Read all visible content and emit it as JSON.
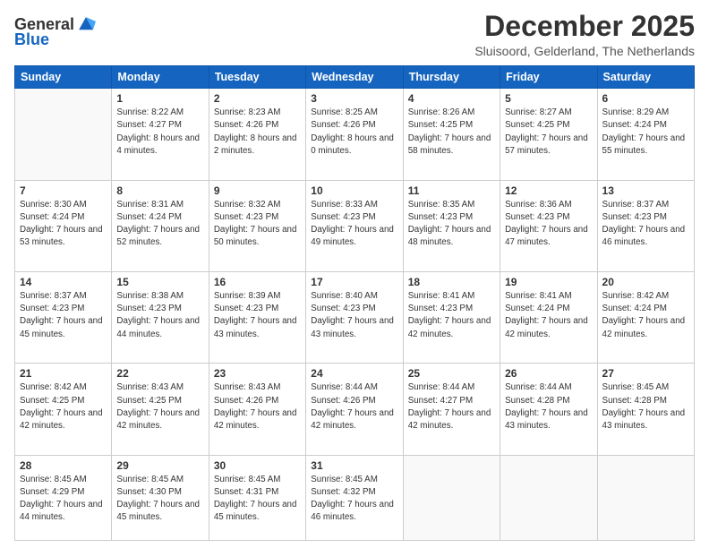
{
  "logo": {
    "general": "General",
    "blue": "Blue"
  },
  "title": {
    "month": "December 2025",
    "location": "Sluisoord, Gelderland, The Netherlands"
  },
  "weekdays": [
    "Sunday",
    "Monday",
    "Tuesday",
    "Wednesday",
    "Thursday",
    "Friday",
    "Saturday"
  ],
  "weeks": [
    [
      {
        "day": "",
        "empty": true
      },
      {
        "day": "1",
        "sunrise": "8:22 AM",
        "sunset": "4:27 PM",
        "daylight": "8 hours and 4 minutes."
      },
      {
        "day": "2",
        "sunrise": "8:23 AM",
        "sunset": "4:26 PM",
        "daylight": "8 hours and 2 minutes."
      },
      {
        "day": "3",
        "sunrise": "8:25 AM",
        "sunset": "4:26 PM",
        "daylight": "8 hours and 0 minutes."
      },
      {
        "day": "4",
        "sunrise": "8:26 AM",
        "sunset": "4:25 PM",
        "daylight": "7 hours and 58 minutes."
      },
      {
        "day": "5",
        "sunrise": "8:27 AM",
        "sunset": "4:25 PM",
        "daylight": "7 hours and 57 minutes."
      },
      {
        "day": "6",
        "sunrise": "8:29 AM",
        "sunset": "4:24 PM",
        "daylight": "7 hours and 55 minutes."
      }
    ],
    [
      {
        "day": "7",
        "sunrise": "8:30 AM",
        "sunset": "4:24 PM",
        "daylight": "7 hours and 53 minutes."
      },
      {
        "day": "8",
        "sunrise": "8:31 AM",
        "sunset": "4:24 PM",
        "daylight": "7 hours and 52 minutes."
      },
      {
        "day": "9",
        "sunrise": "8:32 AM",
        "sunset": "4:23 PM",
        "daylight": "7 hours and 50 minutes."
      },
      {
        "day": "10",
        "sunrise": "8:33 AM",
        "sunset": "4:23 PM",
        "daylight": "7 hours and 49 minutes."
      },
      {
        "day": "11",
        "sunrise": "8:35 AM",
        "sunset": "4:23 PM",
        "daylight": "7 hours and 48 minutes."
      },
      {
        "day": "12",
        "sunrise": "8:36 AM",
        "sunset": "4:23 PM",
        "daylight": "7 hours and 47 minutes."
      },
      {
        "day": "13",
        "sunrise": "8:37 AM",
        "sunset": "4:23 PM",
        "daylight": "7 hours and 46 minutes."
      }
    ],
    [
      {
        "day": "14",
        "sunrise": "8:37 AM",
        "sunset": "4:23 PM",
        "daylight": "7 hours and 45 minutes."
      },
      {
        "day": "15",
        "sunrise": "8:38 AM",
        "sunset": "4:23 PM",
        "daylight": "7 hours and 44 minutes."
      },
      {
        "day": "16",
        "sunrise": "8:39 AM",
        "sunset": "4:23 PM",
        "daylight": "7 hours and 43 minutes."
      },
      {
        "day": "17",
        "sunrise": "8:40 AM",
        "sunset": "4:23 PM",
        "daylight": "7 hours and 43 minutes."
      },
      {
        "day": "18",
        "sunrise": "8:41 AM",
        "sunset": "4:23 PM",
        "daylight": "7 hours and 42 minutes."
      },
      {
        "day": "19",
        "sunrise": "8:41 AM",
        "sunset": "4:24 PM",
        "daylight": "7 hours and 42 minutes."
      },
      {
        "day": "20",
        "sunrise": "8:42 AM",
        "sunset": "4:24 PM",
        "daylight": "7 hours and 42 minutes."
      }
    ],
    [
      {
        "day": "21",
        "sunrise": "8:42 AM",
        "sunset": "4:25 PM",
        "daylight": "7 hours and 42 minutes."
      },
      {
        "day": "22",
        "sunrise": "8:43 AM",
        "sunset": "4:25 PM",
        "daylight": "7 hours and 42 minutes."
      },
      {
        "day": "23",
        "sunrise": "8:43 AM",
        "sunset": "4:26 PM",
        "daylight": "7 hours and 42 minutes."
      },
      {
        "day": "24",
        "sunrise": "8:44 AM",
        "sunset": "4:26 PM",
        "daylight": "7 hours and 42 minutes."
      },
      {
        "day": "25",
        "sunrise": "8:44 AM",
        "sunset": "4:27 PM",
        "daylight": "7 hours and 42 minutes."
      },
      {
        "day": "26",
        "sunrise": "8:44 AM",
        "sunset": "4:28 PM",
        "daylight": "7 hours and 43 minutes."
      },
      {
        "day": "27",
        "sunrise": "8:45 AM",
        "sunset": "4:28 PM",
        "daylight": "7 hours and 43 minutes."
      }
    ],
    [
      {
        "day": "28",
        "sunrise": "8:45 AM",
        "sunset": "4:29 PM",
        "daylight": "7 hours and 44 minutes."
      },
      {
        "day": "29",
        "sunrise": "8:45 AM",
        "sunset": "4:30 PM",
        "daylight": "7 hours and 45 minutes."
      },
      {
        "day": "30",
        "sunrise": "8:45 AM",
        "sunset": "4:31 PM",
        "daylight": "7 hours and 45 minutes."
      },
      {
        "day": "31",
        "sunrise": "8:45 AM",
        "sunset": "4:32 PM",
        "daylight": "7 hours and 46 minutes."
      },
      {
        "day": "",
        "empty": true
      },
      {
        "day": "",
        "empty": true
      },
      {
        "day": "",
        "empty": true
      }
    ]
  ]
}
